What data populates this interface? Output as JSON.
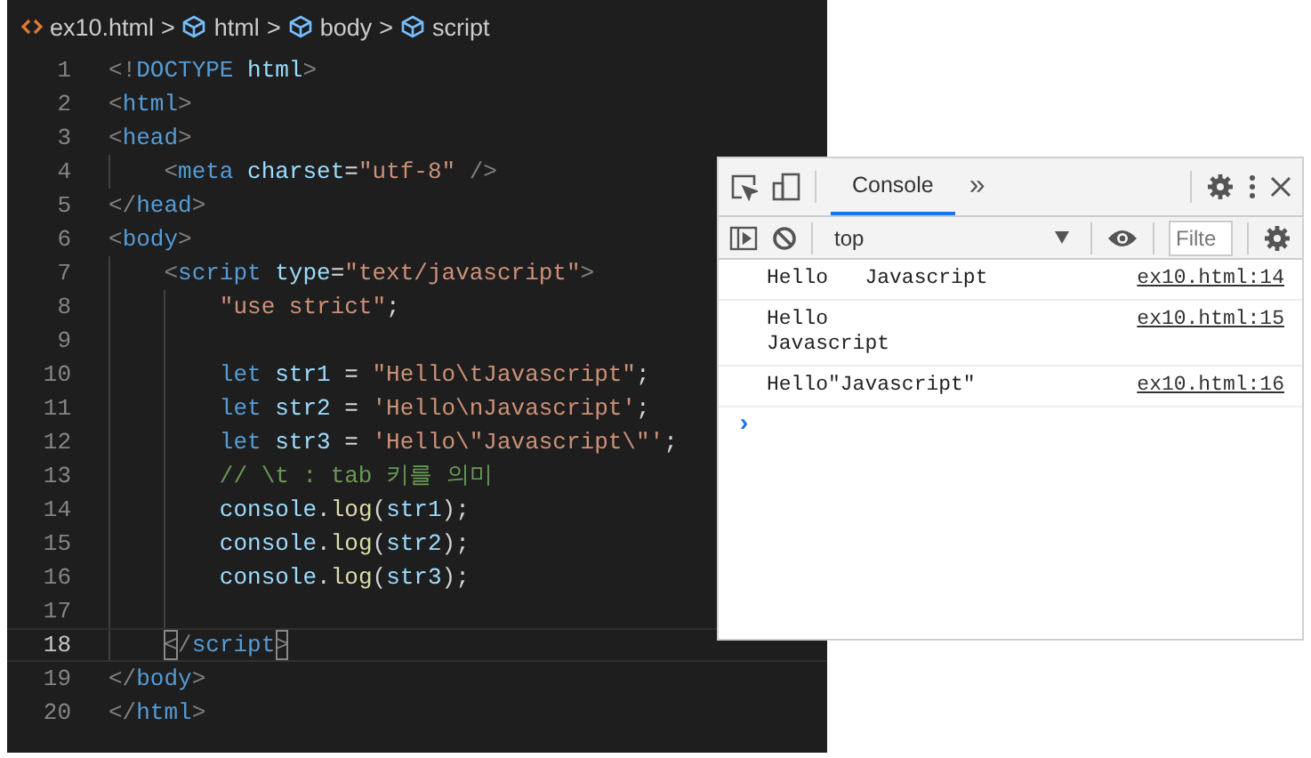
{
  "breadcrumb": [
    {
      "kind": "file",
      "label": "ex10.html"
    },
    {
      "kind": "element",
      "label": "html"
    },
    {
      "kind": "element",
      "label": "body"
    },
    {
      "kind": "element",
      "label": "script"
    }
  ],
  "breadcrumb_separator": ">",
  "editor": {
    "lines": [
      {
        "number": "1",
        "current": false,
        "tokens": [
          {
            "kind": "punct",
            "text": "<!"
          },
          {
            "kind": "tag",
            "text": "DOCTYPE"
          },
          {
            "kind": "attr",
            "text": " html"
          },
          {
            "kind": "punct",
            "text": ">"
          }
        ]
      },
      {
        "number": "2",
        "current": false,
        "tokens": [
          {
            "kind": "punct",
            "text": "<"
          },
          {
            "kind": "tag",
            "text": "html"
          },
          {
            "kind": "punct",
            "text": ">"
          }
        ]
      },
      {
        "number": "3",
        "current": false,
        "tokens": [
          {
            "kind": "punct",
            "text": "<"
          },
          {
            "kind": "tag",
            "text": "head"
          },
          {
            "kind": "punct",
            "text": ">"
          }
        ]
      },
      {
        "number": "4",
        "current": false,
        "tokens": [
          {
            "kind": "punct",
            "text": "    <"
          },
          {
            "kind": "tag",
            "text": "meta"
          },
          {
            "kind": "attr",
            "text": " charset"
          },
          {
            "kind": "plain",
            "text": "="
          },
          {
            "kind": "string",
            "text": "\"utf-8\""
          },
          {
            "kind": "punct",
            "text": " />"
          }
        ]
      },
      {
        "number": "5",
        "current": false,
        "tokens": [
          {
            "kind": "punct",
            "text": "</"
          },
          {
            "kind": "tag",
            "text": "head"
          },
          {
            "kind": "punct",
            "text": ">"
          }
        ]
      },
      {
        "number": "6",
        "current": false,
        "tokens": [
          {
            "kind": "punct",
            "text": "<"
          },
          {
            "kind": "tag",
            "text": "body"
          },
          {
            "kind": "punct",
            "text": ">"
          }
        ]
      },
      {
        "number": "7",
        "current": false,
        "tokens": [
          {
            "kind": "punct",
            "text": "    <"
          },
          {
            "kind": "tag",
            "text": "script"
          },
          {
            "kind": "attr",
            "text": " type"
          },
          {
            "kind": "plain",
            "text": "="
          },
          {
            "kind": "string",
            "text": "\"text/javascript\""
          },
          {
            "kind": "punct",
            "text": ">"
          }
        ]
      },
      {
        "number": "8",
        "current": false,
        "tokens": [
          {
            "kind": "string",
            "text": "        \"use strict\""
          },
          {
            "kind": "plain",
            "text": ";"
          }
        ]
      },
      {
        "number": "9",
        "current": false
      },
      {
        "number": "10",
        "current": false,
        "tokens": [
          {
            "kind": "keyword",
            "text": "        let"
          },
          {
            "kind": "var",
            "text": " str1"
          },
          {
            "kind": "plain",
            "text": " = "
          },
          {
            "kind": "string",
            "text": "\"Hello\\tJavascript\""
          },
          {
            "kind": "plain",
            "text": ";"
          }
        ]
      },
      {
        "number": "11",
        "current": false,
        "tokens": [
          {
            "kind": "keyword",
            "text": "        let"
          },
          {
            "kind": "var",
            "text": " str2"
          },
          {
            "kind": "plain",
            "text": " = "
          },
          {
            "kind": "string",
            "text": "'Hello\\nJavascript'"
          },
          {
            "kind": "plain",
            "text": ";"
          }
        ]
      },
      {
        "number": "12",
        "current": false,
        "tokens": [
          {
            "kind": "keyword",
            "text": "        let"
          },
          {
            "kind": "var",
            "text": " str3"
          },
          {
            "kind": "plain",
            "text": " = "
          },
          {
            "kind": "string",
            "text": "'Hello\\\"Javascript\\\"'"
          },
          {
            "kind": "plain",
            "text": ";"
          }
        ]
      },
      {
        "number": "13",
        "current": false,
        "tokens": [
          {
            "kind": "comment",
            "text": "        // \\t : tab 키를 의미"
          }
        ]
      },
      {
        "number": "14",
        "current": false,
        "tokens": [
          {
            "kind": "var",
            "text": "        console"
          },
          {
            "kind": "plain",
            "text": "."
          },
          {
            "kind": "func",
            "text": "log"
          },
          {
            "kind": "plain",
            "text": "("
          },
          {
            "kind": "var",
            "text": "str1"
          },
          {
            "kind": "plain",
            "text": ");"
          }
        ]
      },
      {
        "number": "15",
        "current": false,
        "tokens": [
          {
            "kind": "var",
            "text": "        console"
          },
          {
            "kind": "plain",
            "text": "."
          },
          {
            "kind": "func",
            "text": "log"
          },
          {
            "kind": "plain",
            "text": "("
          },
          {
            "kind": "var",
            "text": "str2"
          },
          {
            "kind": "plain",
            "text": ");"
          }
        ]
      },
      {
        "number": "16",
        "current": false,
        "tokens": [
          {
            "kind": "var",
            "text": "        console"
          },
          {
            "kind": "plain",
            "text": "."
          },
          {
            "kind": "func",
            "text": "log"
          },
          {
            "kind": "plain",
            "text": "("
          },
          {
            "kind": "var",
            "text": "str3"
          },
          {
            "kind": "plain",
            "text": ");"
          }
        ]
      },
      {
        "number": "17",
        "current": false
      },
      {
        "number": "18",
        "current": true,
        "tokens": [
          {
            "kind": "match",
            "text": "<"
          },
          {
            "kind": "punct",
            "text": "/"
          },
          {
            "kind": "tag",
            "text": "script"
          },
          {
            "kind": "match",
            "text": ">"
          }
        ]
      },
      {
        "number": "19",
        "current": false,
        "tokens": [
          {
            "kind": "punct",
            "text": "</"
          },
          {
            "kind": "tag",
            "text": "body"
          },
          {
            "kind": "punct",
            "text": ">"
          }
        ]
      },
      {
        "number": "20",
        "current": false,
        "tokens": [
          {
            "kind": "punct",
            "text": "</"
          },
          {
            "kind": "tag",
            "text": "html"
          },
          {
            "kind": "punct",
            "text": ">"
          }
        ]
      }
    ]
  },
  "devtools": {
    "tabs": [
      {
        "label": "Console",
        "selected": true
      }
    ],
    "more": "»",
    "context": "top",
    "filter": {
      "placeholder": "Filte"
    },
    "messages": [
      {
        "text": "Hello\tJavascript",
        "source": "ex10.html:14"
      },
      {
        "text": "Hello\nJavascript",
        "source": "ex10.html:15"
      },
      {
        "text": "Hello\"Javascript\"",
        "source": "ex10.html:16"
      }
    ],
    "prompt": "›"
  }
}
